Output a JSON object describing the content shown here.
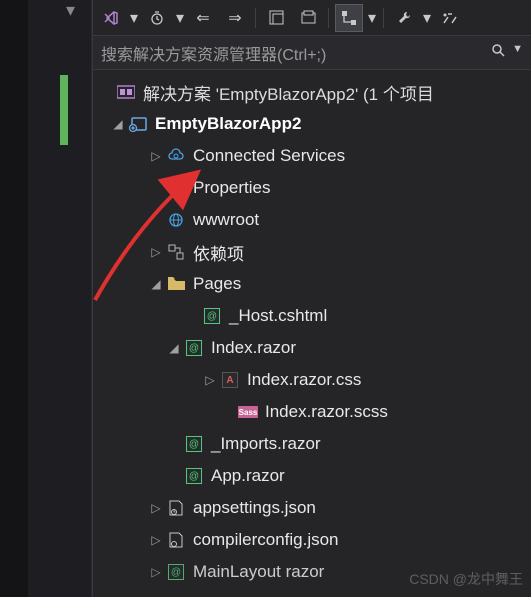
{
  "toolbar": {
    "icons": [
      "vs-logo",
      "history",
      "back",
      "forward",
      "collapse",
      "sync",
      "tree-view",
      "wrench",
      "advanced"
    ]
  },
  "search": {
    "placeholder": "搜索解决方案资源管理器(Ctrl+;)"
  },
  "solution": {
    "label": "解决方案 'EmptyBlazorApp2' (1 个项目"
  },
  "project": {
    "label": "EmptyBlazorApp2"
  },
  "nodes": {
    "connected_services": "Connected Services",
    "properties": "Properties",
    "wwwroot": "wwwroot",
    "dependencies": "依赖项",
    "pages": "Pages",
    "host": "_Host.cshtml",
    "index": "Index.razor",
    "index_css": "Index.razor.css",
    "index_scss": "Index.razor.scss",
    "imports": "_Imports.razor",
    "app": "App.razor",
    "appsettings": "appsettings.json",
    "compilerconfig": "compilerconfig.json",
    "mainlayout": "MainLayout razor"
  },
  "watermark": "CSDN @龙中舞王"
}
